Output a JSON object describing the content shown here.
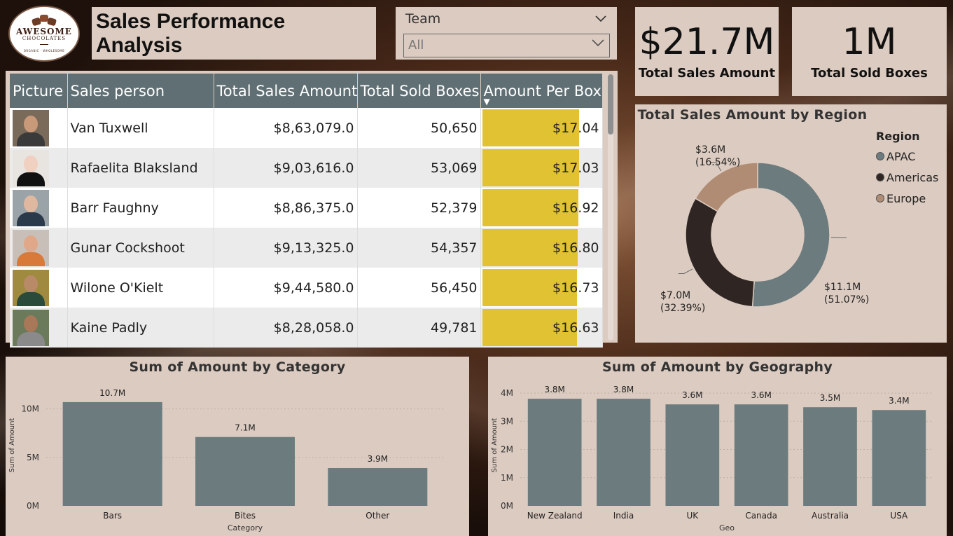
{
  "logo": {
    "line1": "AWESOME",
    "line2": "CHOCOLATES",
    "tagline": "ORGANIC · WHOLESOME"
  },
  "title": "Sales Performance Analysis",
  "slicer": {
    "label": "Team",
    "value": "All"
  },
  "kpis": [
    {
      "value": "$21.7M",
      "label": "Total Sales Amount"
    },
    {
      "value": "1M",
      "label": "Total Sold Boxes"
    }
  ],
  "table": {
    "headers": [
      "Picture",
      "Sales person",
      "Total Sales Amount",
      "Total Sold Boxes",
      "Amount Per Box"
    ],
    "rows": [
      {
        "name": "Van Tuxwell",
        "sales": "$8,63,079.0",
        "boxes": "50,650",
        "per_box": "$17.04",
        "per_box_value": 17.04
      },
      {
        "name": "Rafaelita Blaksland",
        "sales": "$9,03,616.0",
        "boxes": "53,069",
        "per_box": "$17.03",
        "per_box_value": 17.03
      },
      {
        "name": "Barr Faughny",
        "sales": "$8,86,375.0",
        "boxes": "52,379",
        "per_box": "$16.92",
        "per_box_value": 16.92
      },
      {
        "name": "Gunar Cockshoot",
        "sales": "$9,13,325.0",
        "boxes": "54,357",
        "per_box": "$16.80",
        "per_box_value": 16.8
      },
      {
        "name": "Wilone O'Kielt",
        "sales": "$9,44,580.0",
        "boxes": "56,450",
        "per_box": "$16.73",
        "per_box_value": 16.73
      },
      {
        "name": "Kaine Padly",
        "sales": "$8,28,058.0",
        "boxes": "49,781",
        "per_box": "$16.63",
        "per_box_value": 16.63
      }
    ]
  },
  "chart_data": [
    {
      "type": "pie",
      "title": "Total Sales Amount by Region",
      "legend_title": "Region",
      "legend_position": "right",
      "slices": [
        {
          "name": "APAC",
          "value": 11.1,
          "label": "$11.1M",
          "pct": "(51.07%)",
          "color": "#6b7b7e"
        },
        {
          "name": "Americas",
          "value": 7.0,
          "label": "$7.0M",
          "pct": "(32.39%)",
          "color": "#2f2624"
        },
        {
          "name": "Europe",
          "value": 3.6,
          "label": "$3.6M",
          "pct": "(16.54%)",
          "color": "#b08c74"
        }
      ]
    },
    {
      "type": "bar",
      "title": "Sum of Amount by Category",
      "xlabel": "Category",
      "ylabel": "Sum of Amount",
      "categories": [
        "Bars",
        "Bites",
        "Other"
      ],
      "values": [
        10.7,
        7.1,
        3.9
      ],
      "data_labels": [
        "10.7M",
        "7.1M",
        "3.9M"
      ],
      "yticks": [
        "0M",
        "5M",
        "10M"
      ],
      "ylim": [
        0,
        12.5
      ],
      "color": "#6b7b7e"
    },
    {
      "type": "bar",
      "title": "Sum of Amount by Geography",
      "xlabel": "Geo",
      "ylabel": "Sum of Amount",
      "categories": [
        "New Zealand",
        "India",
        "UK",
        "Canada",
        "Australia",
        "USA"
      ],
      "values": [
        3.8,
        3.8,
        3.6,
        3.6,
        3.5,
        3.4
      ],
      "data_labels": [
        "3.8M",
        "3.8M",
        "3.6M",
        "3.6M",
        "3.5M",
        "3.4M"
      ],
      "yticks": [
        "0M",
        "1M",
        "2M",
        "3M",
        "4M"
      ],
      "ylim": [
        0,
        4.3
      ],
      "color": "#6b7b7e"
    }
  ]
}
